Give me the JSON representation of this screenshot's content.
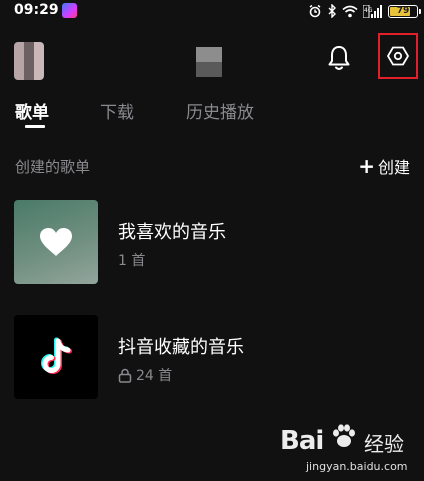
{
  "status_bar": {
    "time": "09:29",
    "battery": "79",
    "icons": [
      "alarm-icon",
      "bluetooth-icon",
      "wifi-icon",
      "cellular-signal-icon",
      "battery-icon"
    ]
  },
  "header": {
    "icons": [
      "bell-icon",
      "settings-icon"
    ],
    "highlight_color": "#e0202a"
  },
  "tabs": [
    {
      "label": "歌单",
      "active": true
    },
    {
      "label": "下载",
      "active": false
    },
    {
      "label": "历史播放",
      "active": false
    }
  ],
  "section": {
    "title": "创建的歌单",
    "create_label": "创建"
  },
  "playlists": [
    {
      "title": "我喜欢的音乐",
      "meta": "1 首",
      "icon": "heart-icon",
      "locked": false
    },
    {
      "title": "抖音收藏的音乐",
      "meta": "24 首",
      "icon": "tiktok-icon",
      "locked": true
    }
  ],
  "watermark": {
    "logo": "Bai",
    "text": "经验",
    "url": "jingyan.baidu.com"
  }
}
